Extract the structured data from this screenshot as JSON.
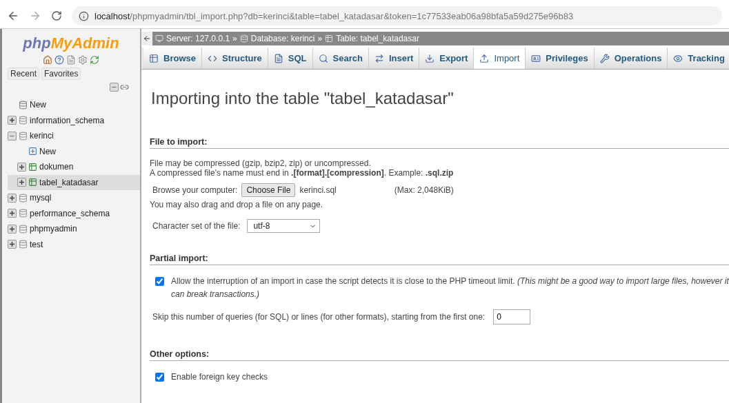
{
  "browser": {
    "url_host": "localhost",
    "url_path": "/phpmyadmin/tbl_import.php?db=kerinci&table=tabel_katadasar&token=1c77533eab06a98bfa5a59d275e96b83"
  },
  "sidebar": {
    "logo_php": "php",
    "logo_myadmin": "MyAdmin",
    "buttons": [
      "Recent",
      "Favorites"
    ],
    "tree": [
      {
        "label": "New",
        "kind": "new",
        "selected": false
      },
      {
        "label": "information_schema",
        "kind": "database",
        "expanded": false,
        "selected": false
      },
      {
        "label": "kerinci",
        "kind": "database",
        "expanded": true,
        "selected": false,
        "children": [
          {
            "label": "New",
            "kind": "new-table",
            "selected": false
          },
          {
            "label": "dokumen",
            "kind": "table",
            "expanded": false,
            "selected": false
          },
          {
            "label": "tabel_katadasar",
            "kind": "table",
            "expanded": false,
            "selected": true
          }
        ]
      },
      {
        "label": "mysql",
        "kind": "database",
        "expanded": false,
        "selected": false
      },
      {
        "label": "performance_schema",
        "kind": "database",
        "expanded": false,
        "selected": false
      },
      {
        "label": "phpmyadmin",
        "kind": "database",
        "expanded": false,
        "selected": false
      },
      {
        "label": "test",
        "kind": "database",
        "expanded": false,
        "selected": false
      }
    ]
  },
  "breadcrumb": {
    "items": [
      "Server: 127.0.0.1",
      "Database: kerinci",
      "Table: tabel_katadasar"
    ],
    "separator": "»"
  },
  "tabs": [
    {
      "label": "Browse",
      "selected": false
    },
    {
      "label": "Structure",
      "selected": false
    },
    {
      "label": "SQL",
      "selected": false
    },
    {
      "label": "Search",
      "selected": false
    },
    {
      "label": "Insert",
      "selected": false
    },
    {
      "label": "Export",
      "selected": false
    },
    {
      "label": "Import",
      "selected": true
    },
    {
      "label": "Privileges",
      "selected": false
    },
    {
      "label": "Operations",
      "selected": false
    },
    {
      "label": "Tracking",
      "selected": false
    }
  ],
  "title": "Importing into the table \"tabel_katadasar\"",
  "file_section": {
    "legend": "File to import:",
    "lines": [
      "File may be compressed (gzip, bzip2, zip) or uncompressed.",
      "A compressed file's name must end in **.[format].[compression]**. Example: **.sql.zip**"
    ],
    "browse_label": "Browse your computer:",
    "choose_button": "Choose File",
    "file_name": "kerinci.sql",
    "max": "(Max: 2,048KiB)",
    "drag_note": "You may also drag and drop a file on any page.",
    "charset_label": "Character set of the file:",
    "charset_value": "utf-8"
  },
  "partial_section": {
    "legend": "Partial import:",
    "allow_checked": true,
    "allow_text": "Allow the interruption of an import in case the script detects it is close to the PHP timeout limit. *(This might be a good way to import large files, however it can break transactions.)*",
    "skip_label": "Skip this number of queries (for SQL) or lines (for other formats), starting from the first one:",
    "skip_value": "0"
  },
  "other_section": {
    "legend": "Other options:",
    "fk_checked": true,
    "fk_label": "Enable foreign key checks"
  }
}
